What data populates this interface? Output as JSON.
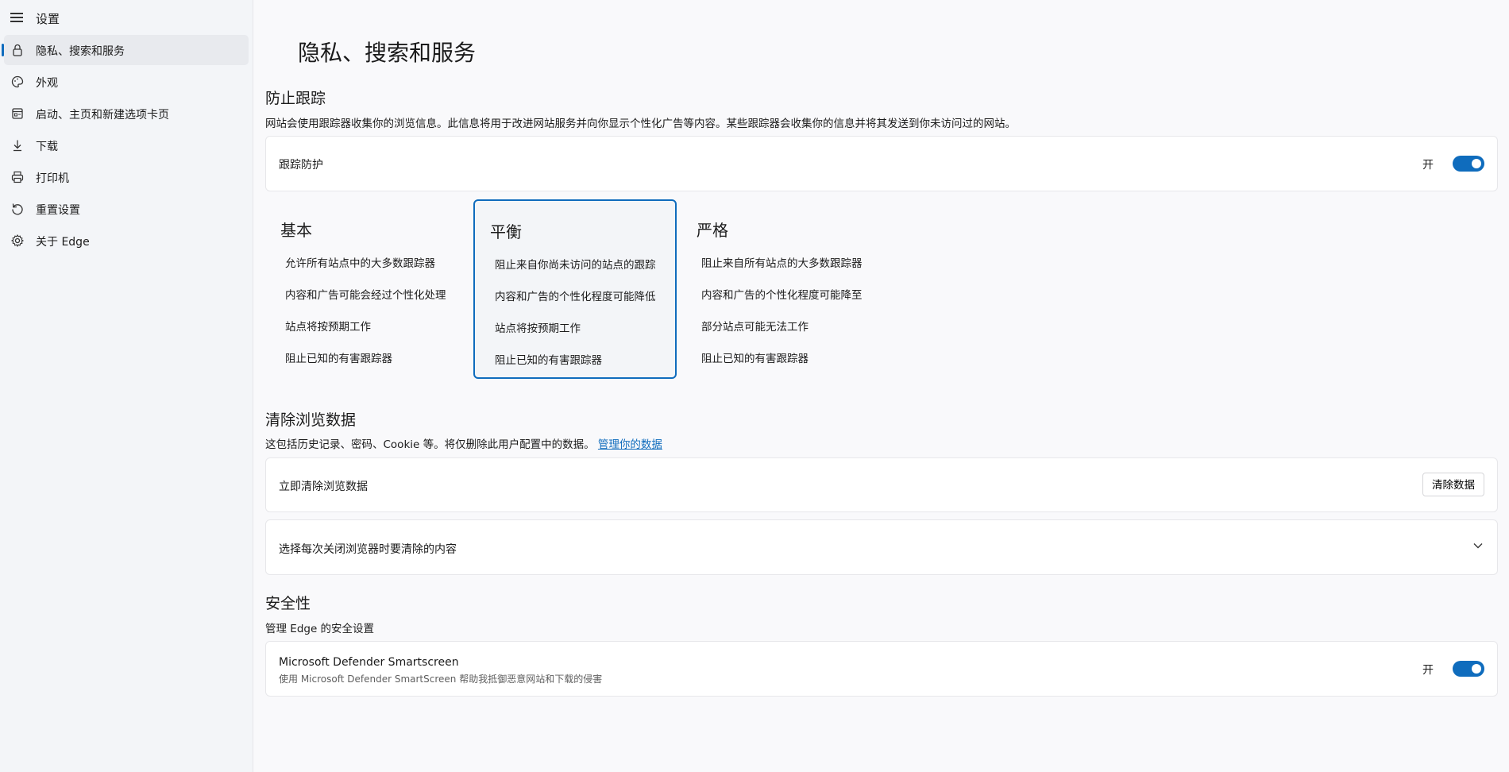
{
  "sidebar": {
    "title": "设置",
    "items": [
      {
        "label": "隐私、搜索和服务",
        "icon": "lock-icon",
        "active": true
      },
      {
        "label": "外观",
        "icon": "palette-icon"
      },
      {
        "label": "启动、主页和新建选项卡页",
        "icon": "startup-icon"
      },
      {
        "label": "下载",
        "icon": "download-icon"
      },
      {
        "label": "打印机",
        "icon": "printer-icon"
      },
      {
        "label": "重置设置",
        "icon": "reset-icon"
      },
      {
        "label": "关于 Edge",
        "icon": "gear-icon"
      }
    ]
  },
  "main": {
    "page_title": "隐私、搜索和服务",
    "tracking": {
      "title": "防止跟踪",
      "description": "网站会使用跟踪器收集你的浏览信息。此信息将用于改进网站服务并向你显示个性化广告等内容。某些跟踪器会收集你的信息并将其发送到你未访问过的网站。",
      "protection_label": "跟踪防护",
      "toggle_text": "开",
      "toggle_on": true,
      "levels": [
        {
          "title": "基本",
          "lines": [
            "允许所有站点中的大多数跟踪器",
            "内容和广告可能会经过个性化处理",
            "站点将按预期工作",
            "阻止已知的有害跟踪器"
          ],
          "selected": false
        },
        {
          "title": "平衡",
          "lines": [
            "阻止来自你尚未访问的站点的跟踪",
            "内容和广告的个性化程度可能降低",
            "站点将按预期工作",
            "阻止已知的有害跟踪器"
          ],
          "selected": true
        },
        {
          "title": "严格",
          "lines": [
            "阻止来自所有站点的大多数跟踪器",
            "内容和广告的个性化程度可能降至",
            "部分站点可能无法工作",
            "阻止已知的有害跟踪器"
          ],
          "selected": false
        }
      ]
    },
    "clear_data": {
      "title": "清除浏览数据",
      "description": "这包括历史记录、密码、Cookie 等。将仅删除此用户配置中的数据。",
      "link_text": "管理你的数据",
      "clear_now_label": "立即清除浏览数据",
      "clear_button": "清除数据",
      "choose_label": "选择每次关闭浏览器时要清除的内容"
    },
    "security": {
      "title": "安全性",
      "description": "管理 Edge 的安全设置",
      "smartscreen_title": "Microsoft Defender Smartscreen",
      "smartscreen_desc": "使用 Microsoft Defender SmartScreen 帮助我抵御恶意网站和下载的侵害",
      "toggle_text": "开",
      "toggle_on": true
    }
  },
  "colors": {
    "accent": "#0f6cbd",
    "sidebar_bg": "#f3f5f8",
    "card_bg": "#ffffff"
  }
}
